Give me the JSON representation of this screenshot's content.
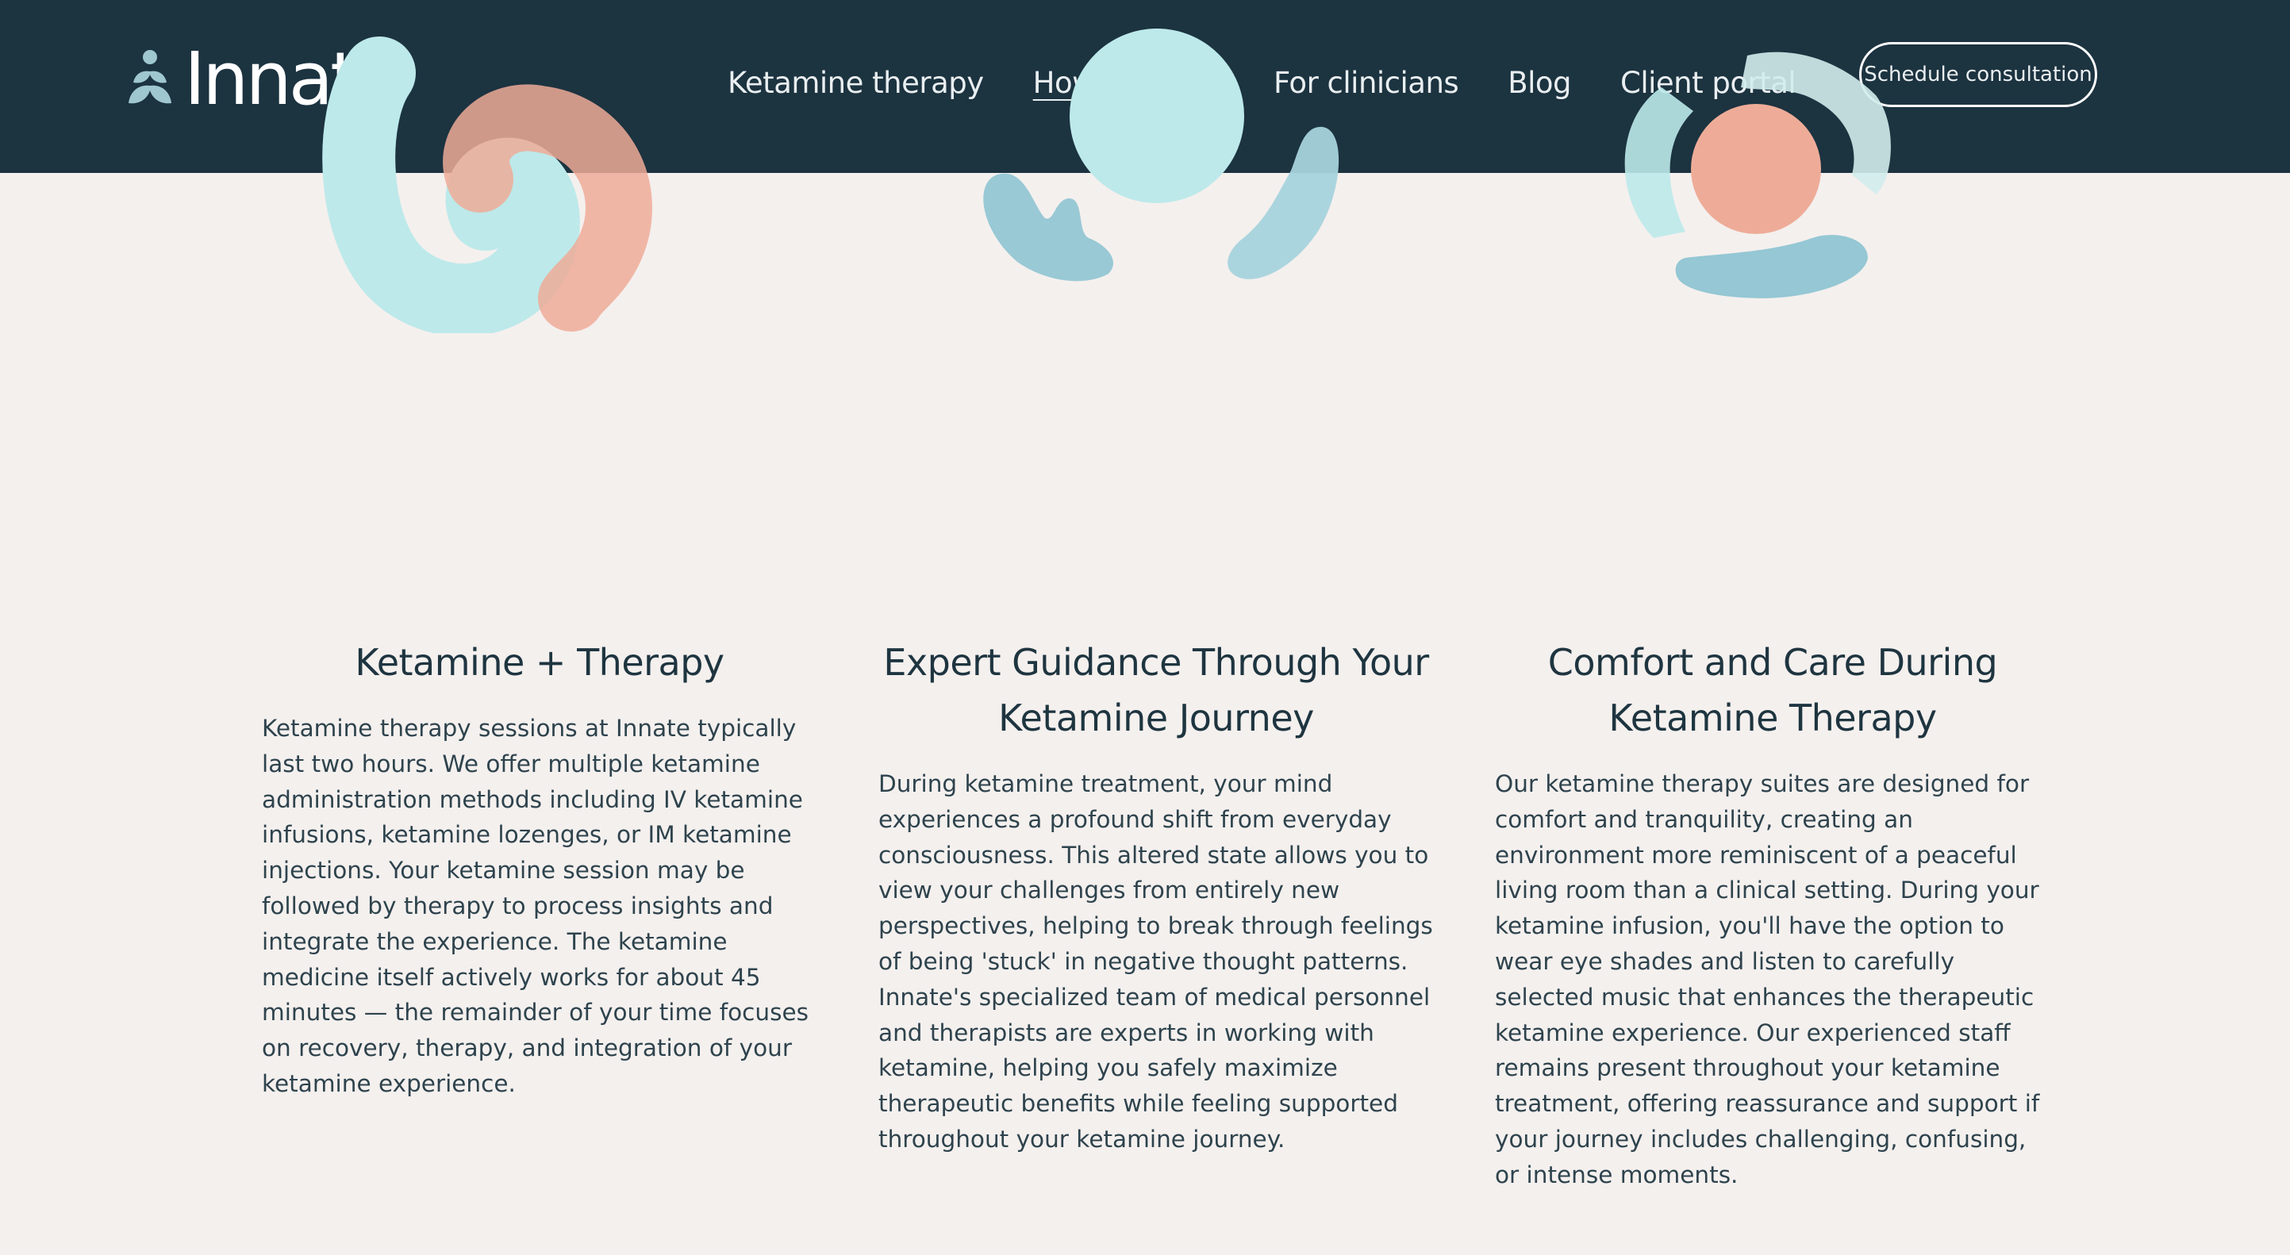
{
  "header": {
    "logo_text": "Innate",
    "nav": [
      {
        "label": "Ketamine therapy"
      },
      {
        "label": "How we work",
        "active": true
      },
      {
        "label": "For clinicians"
      },
      {
        "label": "Blog"
      },
      {
        "label": "Client portal"
      }
    ],
    "cta_label": "Schedule consultation"
  },
  "colors": {
    "header_bg": "#1c3340",
    "page_bg": "#f4f0ee",
    "aqua": "#bde9ea",
    "coral": "#eeac98",
    "blue": "#8fc4d2",
    "text": "#1e3540"
  },
  "cards": [
    {
      "illustration": "swirl-illustration",
      "title": "Ketamine + Therapy",
      "body": "Ketamine therapy sessions at Innate typically last two hours. We offer multiple ketamine administration methods including IV ketamine infusions, ketamine lozenges, or IM ketamine injections. Your ketamine session may be followed by therapy to process insights and integrate the experience. The ketamine medicine itself actively works for about 45 minutes — the remainder of your time focuses on recovery, therapy, and integration of your ketamine experience."
    },
    {
      "illustration": "hands-holding-circle-illustration",
      "title": "Expert Guidance Through Your Ketamine Journey",
      "body": "During ketamine treatment, your mind experiences a profound shift from everyday consciousness. This altered state allows you to view your challenges from entirely new perspectives, helping to break through feelings of being 'stuck' in negative thought patterns. Innate's specialized team of medical personnel and therapists are experts in working with ketamine, helping you safely maximize therapeutic benefits while feeling supported throughout your ketamine journey."
    },
    {
      "illustration": "embrace-circle-illustration",
      "title": "Comfort and Care During Ketamine Therapy",
      "body": "Our ketamine therapy suites are designed for comfort and tranquility, creating an environment more reminiscent of a peaceful living room than a clinical setting. During your ketamine infusion, you'll have the option to wear eye shades and listen to carefully selected music that enhances the therapeutic ketamine experience. Our experienced staff remains present throughout your ketamine treatment, offering reassurance and support if your journey includes challenging, confusing, or intense moments."
    }
  ]
}
